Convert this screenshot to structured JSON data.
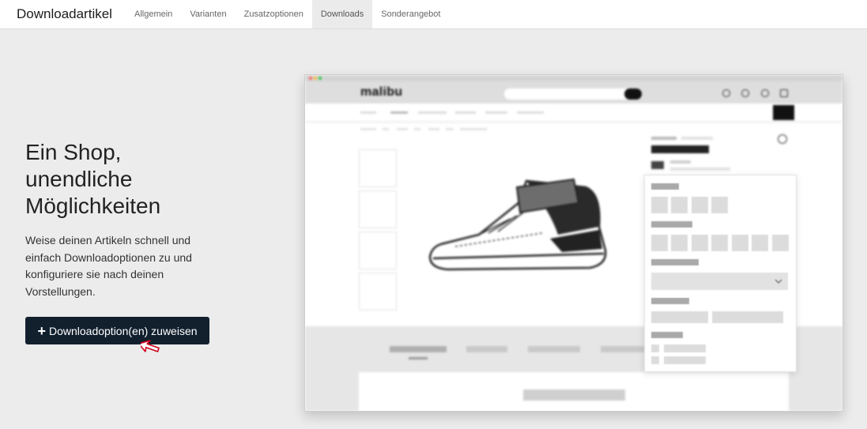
{
  "header": {
    "title": "Downloadartikel",
    "tabs": [
      {
        "label": "Allgemein",
        "active": false
      },
      {
        "label": "Varianten",
        "active": false
      },
      {
        "label": "Zusatzoptionen",
        "active": false
      },
      {
        "label": "Downloads",
        "active": true
      },
      {
        "label": "Sonderangebot",
        "active": false
      }
    ]
  },
  "hero": {
    "title_line1": "Ein Shop,",
    "title_line2": "unendliche",
    "title_line3": "Möglichkeiten",
    "description": "Weise deinen Artikeln schnell und einfach Downloadoptionen zu und konfiguriere sie nach deinen Vorstellungen.",
    "button_label": "Downloadoption(en) zuweisen",
    "button_icon": "plus-icon"
  },
  "preview": {
    "shop_logo": "malibu",
    "header_icons": [
      "globe-icon",
      "user-icon",
      "heart-icon",
      "bag-icon"
    ]
  },
  "colors": {
    "page_background": "#ececec",
    "button_background": "#12202e",
    "cursor_outline": "#d0021b"
  }
}
